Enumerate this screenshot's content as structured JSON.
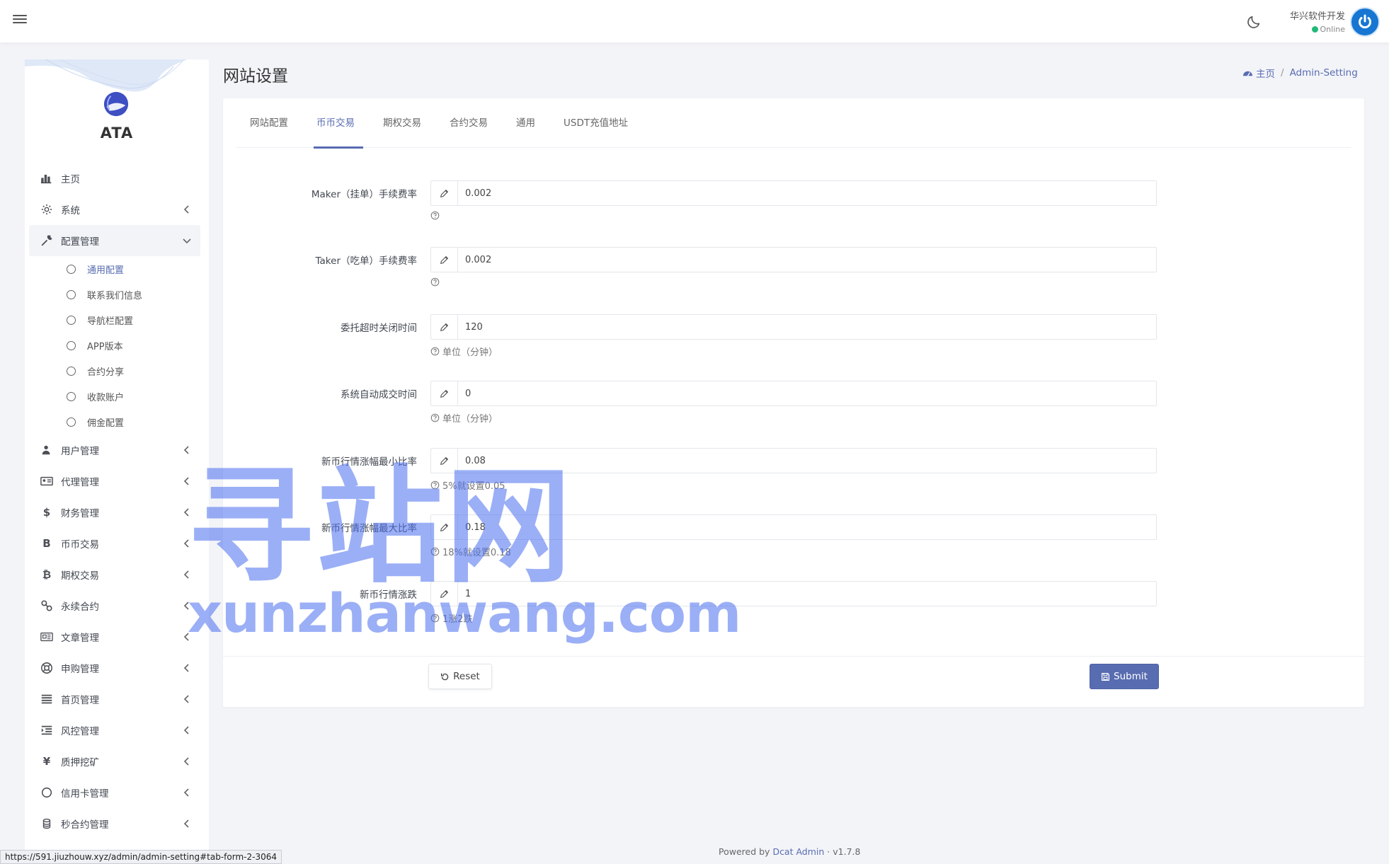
{
  "navbar": {
    "user_name": "华兴软件开发",
    "user_status": "Online"
  },
  "sidebar": {
    "brand": "ATA",
    "items": [
      {
        "label": "主页",
        "icon": "bar-chart-icon"
      },
      {
        "label": "系统",
        "icon": "gear-icon"
      },
      {
        "label": "配置管理",
        "icon": "wrench-icon"
      },
      {
        "label": "用户管理",
        "icon": "users-icon"
      },
      {
        "label": "代理管理",
        "icon": "id-card-icon"
      },
      {
        "label": "财务管理",
        "icon": "dollar-icon",
        "glyph": "$"
      },
      {
        "label": "币币交易",
        "icon": "bold-b-icon",
        "glyph": "B"
      },
      {
        "label": "期权交易",
        "icon": "bitcoin-icon",
        "glyph": "₿"
      },
      {
        "label": "永续合约",
        "icon": "link-icon"
      },
      {
        "label": "文章管理",
        "icon": "newspaper-icon"
      },
      {
        "label": "申购管理",
        "icon": "life-ring-icon"
      },
      {
        "label": "首页管理",
        "icon": "list-icon"
      },
      {
        "label": "风控管理",
        "icon": "indent-icon"
      },
      {
        "label": "质押挖矿",
        "icon": "yen-icon",
        "glyph": "¥"
      },
      {
        "label": "信用卡管理",
        "icon": "circle-icon"
      },
      {
        "label": "秒合约管理",
        "icon": "coins-icon"
      }
    ],
    "sub_items": [
      "通用配置",
      "联系我们信息",
      "导航栏配置",
      "APP版本",
      "合约分享",
      "收款账户",
      "佣金配置"
    ]
  },
  "header": {
    "title": "网站设置",
    "breadcrumb_home": "主页",
    "breadcrumb_current": "Admin-Setting"
  },
  "tabs": [
    "网站配置",
    "币币交易",
    "期权交易",
    "合约交易",
    "通用",
    "USDT充值地址"
  ],
  "form": {
    "fields": [
      {
        "label": "Maker（挂单）手续费率",
        "value": "0.002",
        "help": ""
      },
      {
        "label": "Taker（吃单）手续费率",
        "value": "0.002",
        "help": ""
      },
      {
        "label": "委托超时关闭时间",
        "value": "120",
        "help": "单位（分钟）"
      },
      {
        "label": "系统自动成交时间",
        "value": "0",
        "help": "单位（分钟）"
      },
      {
        "label": "新币行情涨幅最小比率",
        "value": "0.08",
        "help": "5%就设置0.05"
      },
      {
        "label": "新币行情涨幅最大比率",
        "value": "0.18",
        "help": "18%就设置0.18"
      },
      {
        "label": "新币行情涨跌",
        "value": "1",
        "help": "1涨2跌"
      }
    ],
    "reset_label": "Reset",
    "submit_label": "Submit"
  },
  "footer": {
    "powered_by": "Powered by",
    "link": "Dcat Admin",
    "version": "· v1.7.8"
  },
  "status_bar_url": "https://591.jiuzhouw.xyz/admin/admin-setting#tab-form-2-3064",
  "watermark": {
    "text_cn": "寻站网",
    "text_en": "xunzhanwang.com"
  },
  "colors": {
    "accent": "#586cb1",
    "online": "#21b978"
  }
}
